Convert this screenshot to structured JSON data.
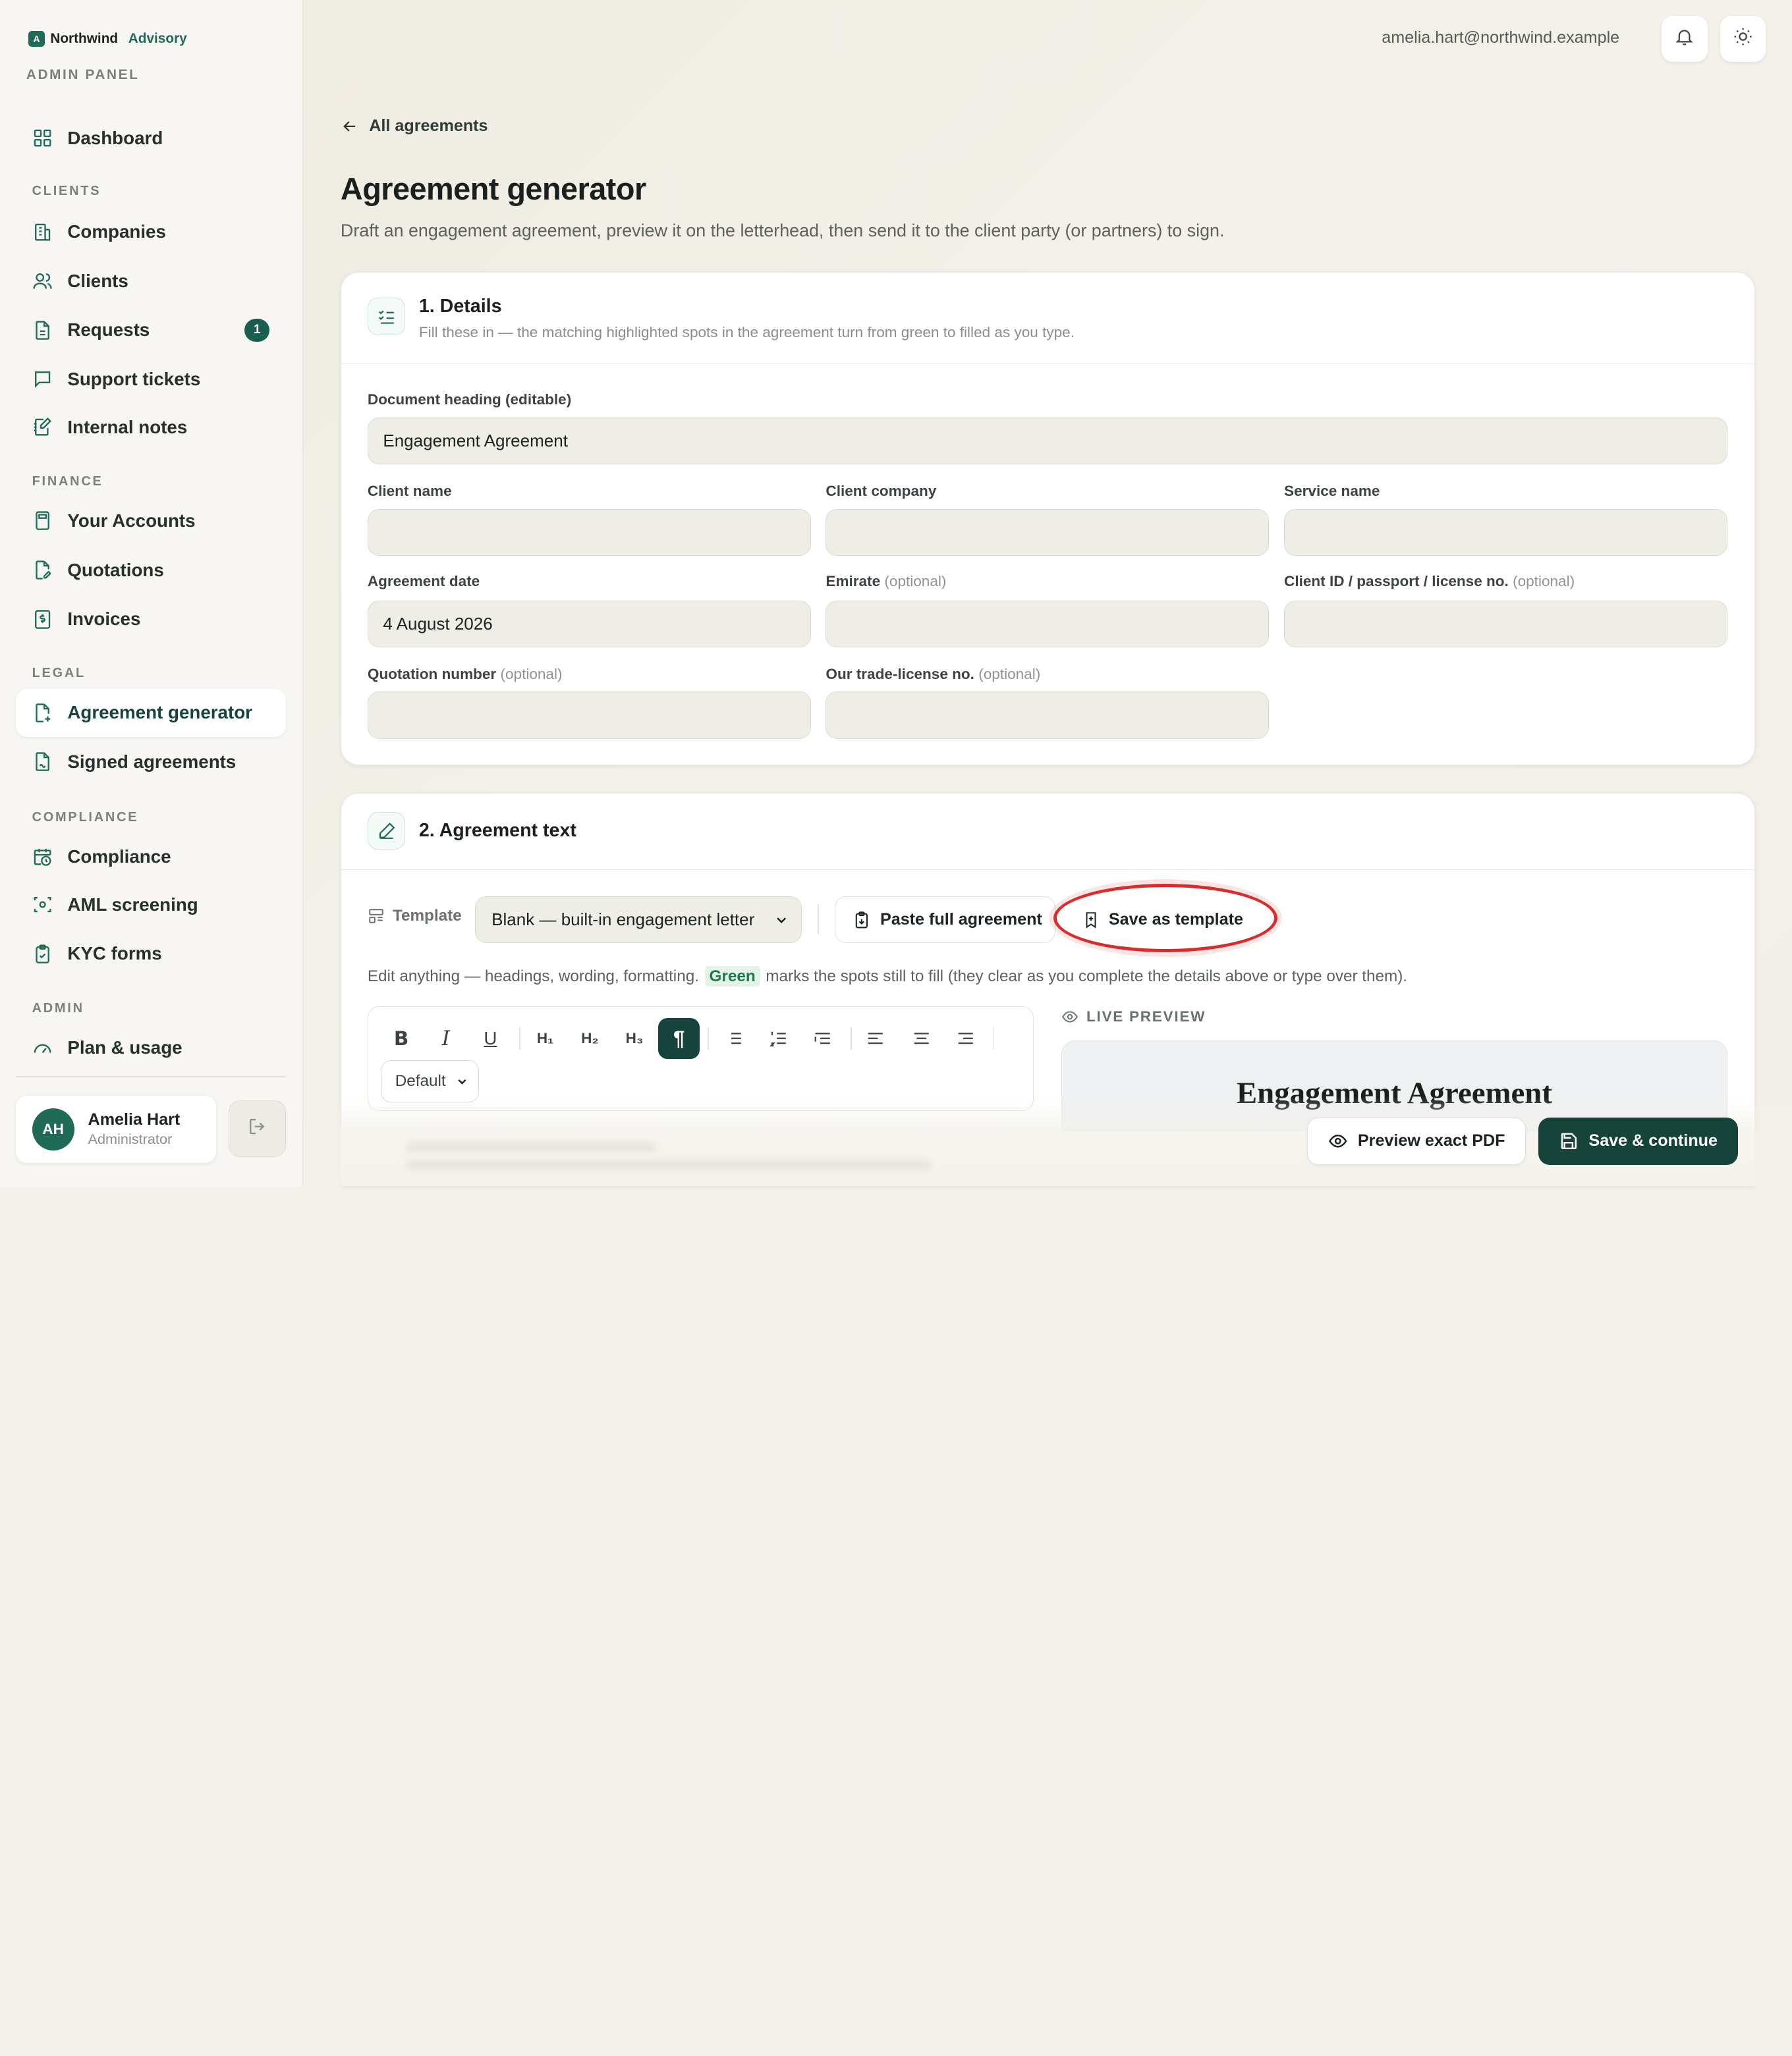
{
  "brand": {
    "logo_letter": "A",
    "name": "Northwind",
    "sub": "Advisory"
  },
  "panel_label": "ADMIN PANEL",
  "nav": {
    "dashboard": "Dashboard",
    "clients_section": "CLIENTS",
    "companies": "Companies",
    "clients": "Clients",
    "requests": "Requests",
    "requests_badge": "1",
    "support": "Support tickets",
    "notes": "Internal notes",
    "finance_section": "FINANCE",
    "accounts": "Your Accounts",
    "quotations": "Quotations",
    "invoices": "Invoices",
    "legal_section": "LEGAL",
    "agreement_generator": "Agreement generator",
    "signed": "Signed agreements",
    "compliance_section": "COMPLIANCE",
    "compliance": "Compliance",
    "aml": "AML screening",
    "kyc": "KYC forms",
    "admin_section": "ADMIN",
    "plan": "Plan & usage"
  },
  "user": {
    "initials": "AH",
    "name": "Amelia Hart",
    "role": "Administrator"
  },
  "topbar": {
    "email": "amelia.hart@northwind.example"
  },
  "back_link": "All agreements",
  "page": {
    "title": "Agreement generator",
    "subtitle": "Draft an engagement agreement, preview it on the letterhead, then send it to the client party (or partners) to sign."
  },
  "details": {
    "title": "1. Details",
    "desc": "Fill these in — the matching highlighted spots in the agreement turn from green to filled as you type.",
    "heading_label": "Document heading (editable)",
    "heading_value": "Engagement Agreement",
    "client_name_label": "Client name",
    "client_company_label": "Client company",
    "service_name_label": "Service name",
    "agreement_date_label": "Agreement date",
    "agreement_date_value": "4 August 2026",
    "emirate_label": "Emirate",
    "client_id_label": "Client ID / passport / license no.",
    "quotation_label": "Quotation number",
    "trade_license_label": "Our trade-license no.",
    "optional": "(optional)"
  },
  "agreement_text": {
    "title": "2. Agreement text",
    "template_label": "Template",
    "template_value": "Blank — built-in engagement letter",
    "paste_button": "Paste full agreement",
    "save_template_button": "Save as template",
    "help_before": "Edit anything — headings, wording, formatting.",
    "help_green": "Green",
    "help_after": "marks the spots still to fill (they clear as you complete the details above or type over them).",
    "toolbar": {
      "h1": "H₁",
      "h2": "H₂",
      "h3": "H₃",
      "style": "Default"
    },
    "preview_label": "LIVE PREVIEW",
    "preview_heading": "Engagement Agreement"
  },
  "actions": {
    "preview_pdf": "Preview exact PDF",
    "save_continue": "Save & continue"
  }
}
